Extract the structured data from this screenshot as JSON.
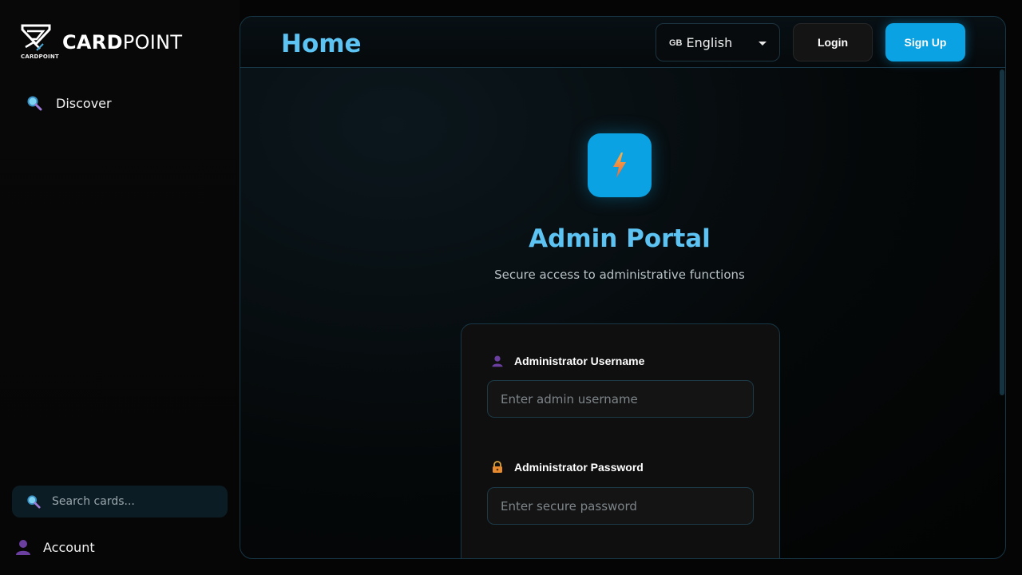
{
  "brand": {
    "bold": "CARD",
    "light": "POINT",
    "logo_sub": "CARDPOINT"
  },
  "sidebar": {
    "items": [
      {
        "label": "Discover",
        "icon": "search-icon"
      }
    ],
    "search": {
      "placeholder": "Search cards...",
      "icon": "search-icon"
    },
    "account": {
      "label": "Account",
      "icon": "user-icon"
    }
  },
  "header": {
    "title": "Home",
    "language": {
      "flag": "GB",
      "label": "English"
    },
    "login_label": "Login",
    "signup_label": "Sign Up"
  },
  "portal": {
    "icon": "lightning-icon",
    "title": "Admin Portal",
    "subtitle": "Secure access to administrative functions",
    "username": {
      "label": "Administrator Username",
      "placeholder": "Enter admin username",
      "icon": "user-icon",
      "value": ""
    },
    "password": {
      "label": "Administrator Password",
      "placeholder": "Enter secure password",
      "icon": "lock-icon",
      "value": ""
    }
  },
  "colors": {
    "accent": "#0aa2e2",
    "title": "#5cc3f2",
    "border": "#173746"
  }
}
